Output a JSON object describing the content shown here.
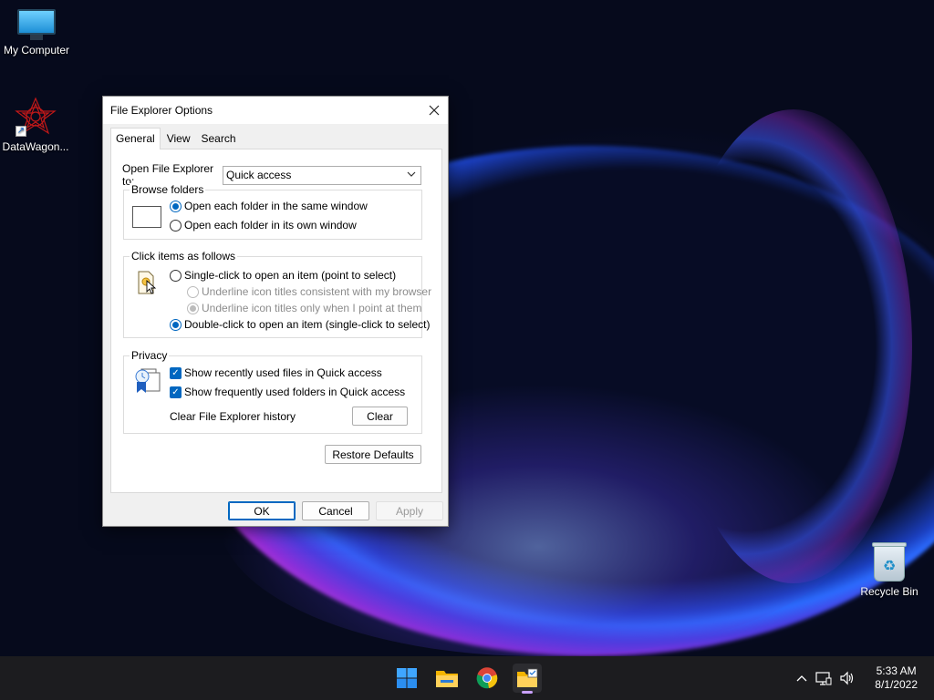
{
  "desktop": {
    "icons": [
      {
        "label": "My Computer"
      },
      {
        "label": "DataWagon..."
      },
      {
        "label": "Recycle Bin"
      }
    ]
  },
  "dialog": {
    "title": "File Explorer Options",
    "tabs": [
      {
        "label": "General",
        "active": true
      },
      {
        "label": "View",
        "active": false
      },
      {
        "label": "Search",
        "active": false
      }
    ],
    "open_to": {
      "label": "Open File Explorer to:",
      "value": "Quick access"
    },
    "browse_folders": {
      "legend": "Browse folders",
      "options": [
        {
          "label": "Open each folder in the same window",
          "selected": true
        },
        {
          "label": "Open each folder in its own window",
          "selected": false
        }
      ]
    },
    "click_items": {
      "legend": "Click items as follows",
      "options": [
        {
          "label": "Single-click to open an item (point to select)",
          "selected": false
        },
        {
          "label": "Underline icon titles consistent with my browser",
          "selected": false,
          "disabled": true
        },
        {
          "label": "Underline icon titles only when I point at them",
          "selected": true,
          "disabled": true
        },
        {
          "label": "Double-click to open an item (single-click to select)",
          "selected": true
        }
      ]
    },
    "privacy": {
      "legend": "Privacy",
      "checks": [
        {
          "label": "Show recently used files in Quick access",
          "checked": true
        },
        {
          "label": "Show frequently used folders in Quick access",
          "checked": true
        }
      ],
      "clear_history_label": "Clear File Explorer history",
      "clear_button": "Clear"
    },
    "restore_defaults_button": "Restore Defaults",
    "buttons": {
      "ok": "OK",
      "cancel": "Cancel",
      "apply": "Apply"
    }
  },
  "taskbar": {
    "apps": [
      "start-icon",
      "file-explorer-icon",
      "chrome-icon",
      "file-explorer-options-icon"
    ],
    "tray_icons": [
      "chevron-up-icon",
      "network-icon",
      "volume-icon"
    ],
    "time": "5:33 AM",
    "date": "8/1/2022"
  }
}
